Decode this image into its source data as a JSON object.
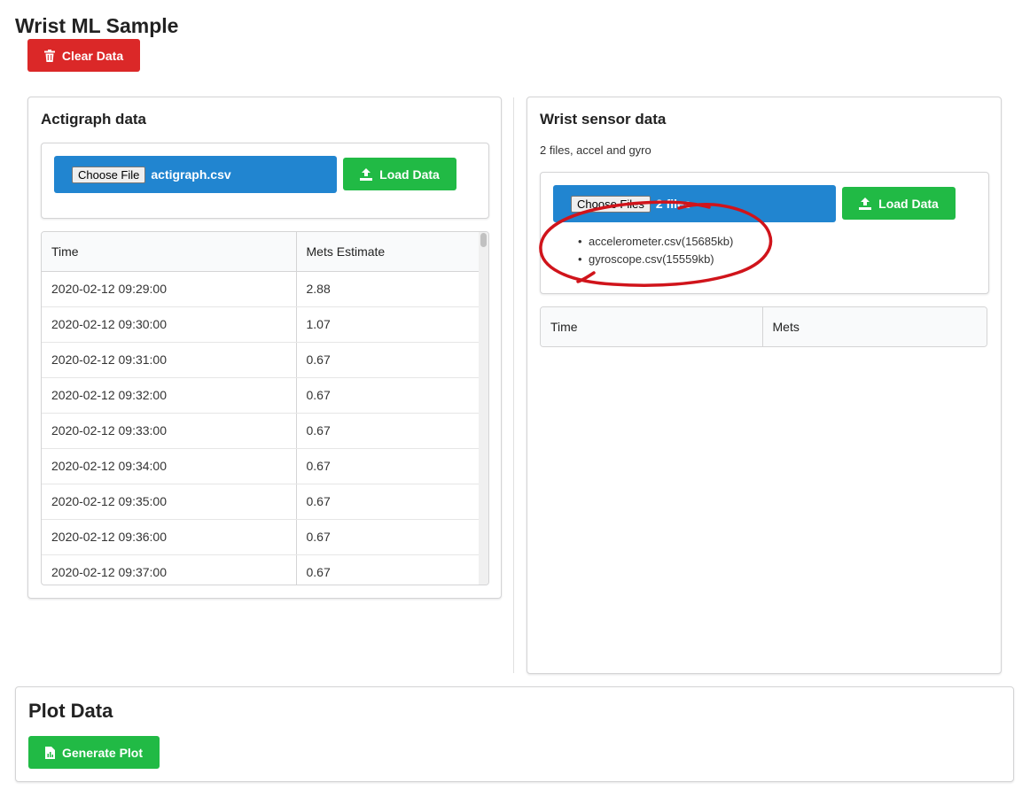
{
  "app": {
    "title": "Wrist ML Sample"
  },
  "toolbar": {
    "clear_label": "Clear Data",
    "clear_icon": "trash-icon"
  },
  "actigraph": {
    "title": "Actigraph data",
    "choose_file_label": "Choose File",
    "file_name": "actigraph.csv",
    "load_label": "Load Data",
    "columns": [
      "Time",
      "Mets Estimate"
    ],
    "rows": [
      [
        "2020-02-12 09:29:00",
        "2.88"
      ],
      [
        "2020-02-12 09:30:00",
        "1.07"
      ],
      [
        "2020-02-12 09:31:00",
        "0.67"
      ],
      [
        "2020-02-12 09:32:00",
        "0.67"
      ],
      [
        "2020-02-12 09:33:00",
        "0.67"
      ],
      [
        "2020-02-12 09:34:00",
        "0.67"
      ],
      [
        "2020-02-12 09:35:00",
        "0.67"
      ],
      [
        "2020-02-12 09:36:00",
        "0.67"
      ],
      [
        "2020-02-12 09:37:00",
        "0.67"
      ]
    ]
  },
  "wrist": {
    "title": "Wrist sensor data",
    "subtitle": "2 files, accel and gyro",
    "choose_files_label": "Choose Files",
    "files_count": "2 files",
    "load_label": "Load Data",
    "file_list": [
      "accelerometer.csv(15685kb)",
      "gyroscope.csv(15559kb)"
    ],
    "columns": [
      "Time",
      "Mets"
    ]
  },
  "plot": {
    "title": "Plot Data",
    "generate_label": "Generate Plot"
  },
  "colors": {
    "red": "#db2828",
    "green": "#21ba45",
    "blue": "#2185d0",
    "annotation": "#d0141b"
  }
}
